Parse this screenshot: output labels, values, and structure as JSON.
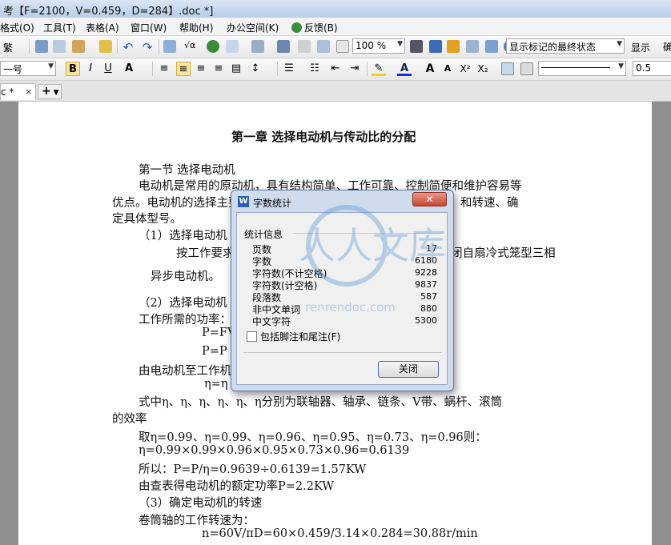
{
  "window": {
    "title": "考【F=2100，V=0.459，D=284】.doc *]"
  },
  "menu": [
    "格式(O)",
    "工具(T)",
    "表格(A)",
    "窗口(W)",
    "帮助(H)",
    "办公空间(K)",
    "反馈(B)"
  ],
  "toolbar": {
    "zoom": "100 %",
    "markup_state": "显示标记的最终状态",
    "show_label": "显示",
    "font_size": "一号",
    "line_width": "0.5"
  },
  "tabs": {
    "active": "c *",
    "close": "×",
    "add": "+"
  },
  "document": {
    "chapter_title": "第一章   选择电动机与传动比的分配",
    "lines": [
      "第一节 选择电动机",
      "电动机是常用的原动机，具有结构简单、工作可靠、控制简便和维护容易等",
      "优点。电动机的选择主要包括选择其类型和结构形式、容量（功率）和转速、确",
      "定具体型号。",
      "（1）选择电动机",
      "按工作要求和条件，选用Y系列三相异步电动机，全封闭自扇冷式笼型三相",
      "异步电动机。",
      "（2）选择电动机",
      "工作所需的功率：",
      "P=FV",
      "P=P",
      "由电动机至工作机",
      "η=η",
      "式中η、η、η、η、η、η分别为联轴器、轴承、链条、V带、蜗杆、滚筒",
      "的效率",
      "取η=0.99、η=0.99、η=0.96、η=0.95、η=0.73、η=0.96则：",
      "η=0.99×0.99×0.96×0.95×0.73×0.96=0.6139",
      "所以：P=P/η=0.9639÷0.6139=1.57KW",
      "由查表得电动机的额定功率P=2.2KW",
      "（3）确定电动机的转速",
      "卷筒轴的工作转速为：",
      "n=60V/πD=60×0.459/3.14×0.284=30.88r/min"
    ]
  },
  "dialog": {
    "title": "字数统计",
    "close_x": "✕",
    "group_label": "统计信息",
    "stats": [
      {
        "label": "页数",
        "value": "17"
      },
      {
        "label": "字数",
        "value": "6180"
      },
      {
        "label": "字符数(不计空格)",
        "value": "9228"
      },
      {
        "label": "字符数(计空格)",
        "value": "9837"
      },
      {
        "label": "段落数",
        "value": "587"
      },
      {
        "label": "非中文单词",
        "value": "880"
      },
      {
        "label": "中文字符",
        "value": "5300"
      }
    ],
    "checkbox_label": "包括脚注和尾注(F)",
    "close_button": "关闭"
  },
  "watermark": {
    "text_cn": "人人文库",
    "text_url": "renrendoc.com"
  }
}
